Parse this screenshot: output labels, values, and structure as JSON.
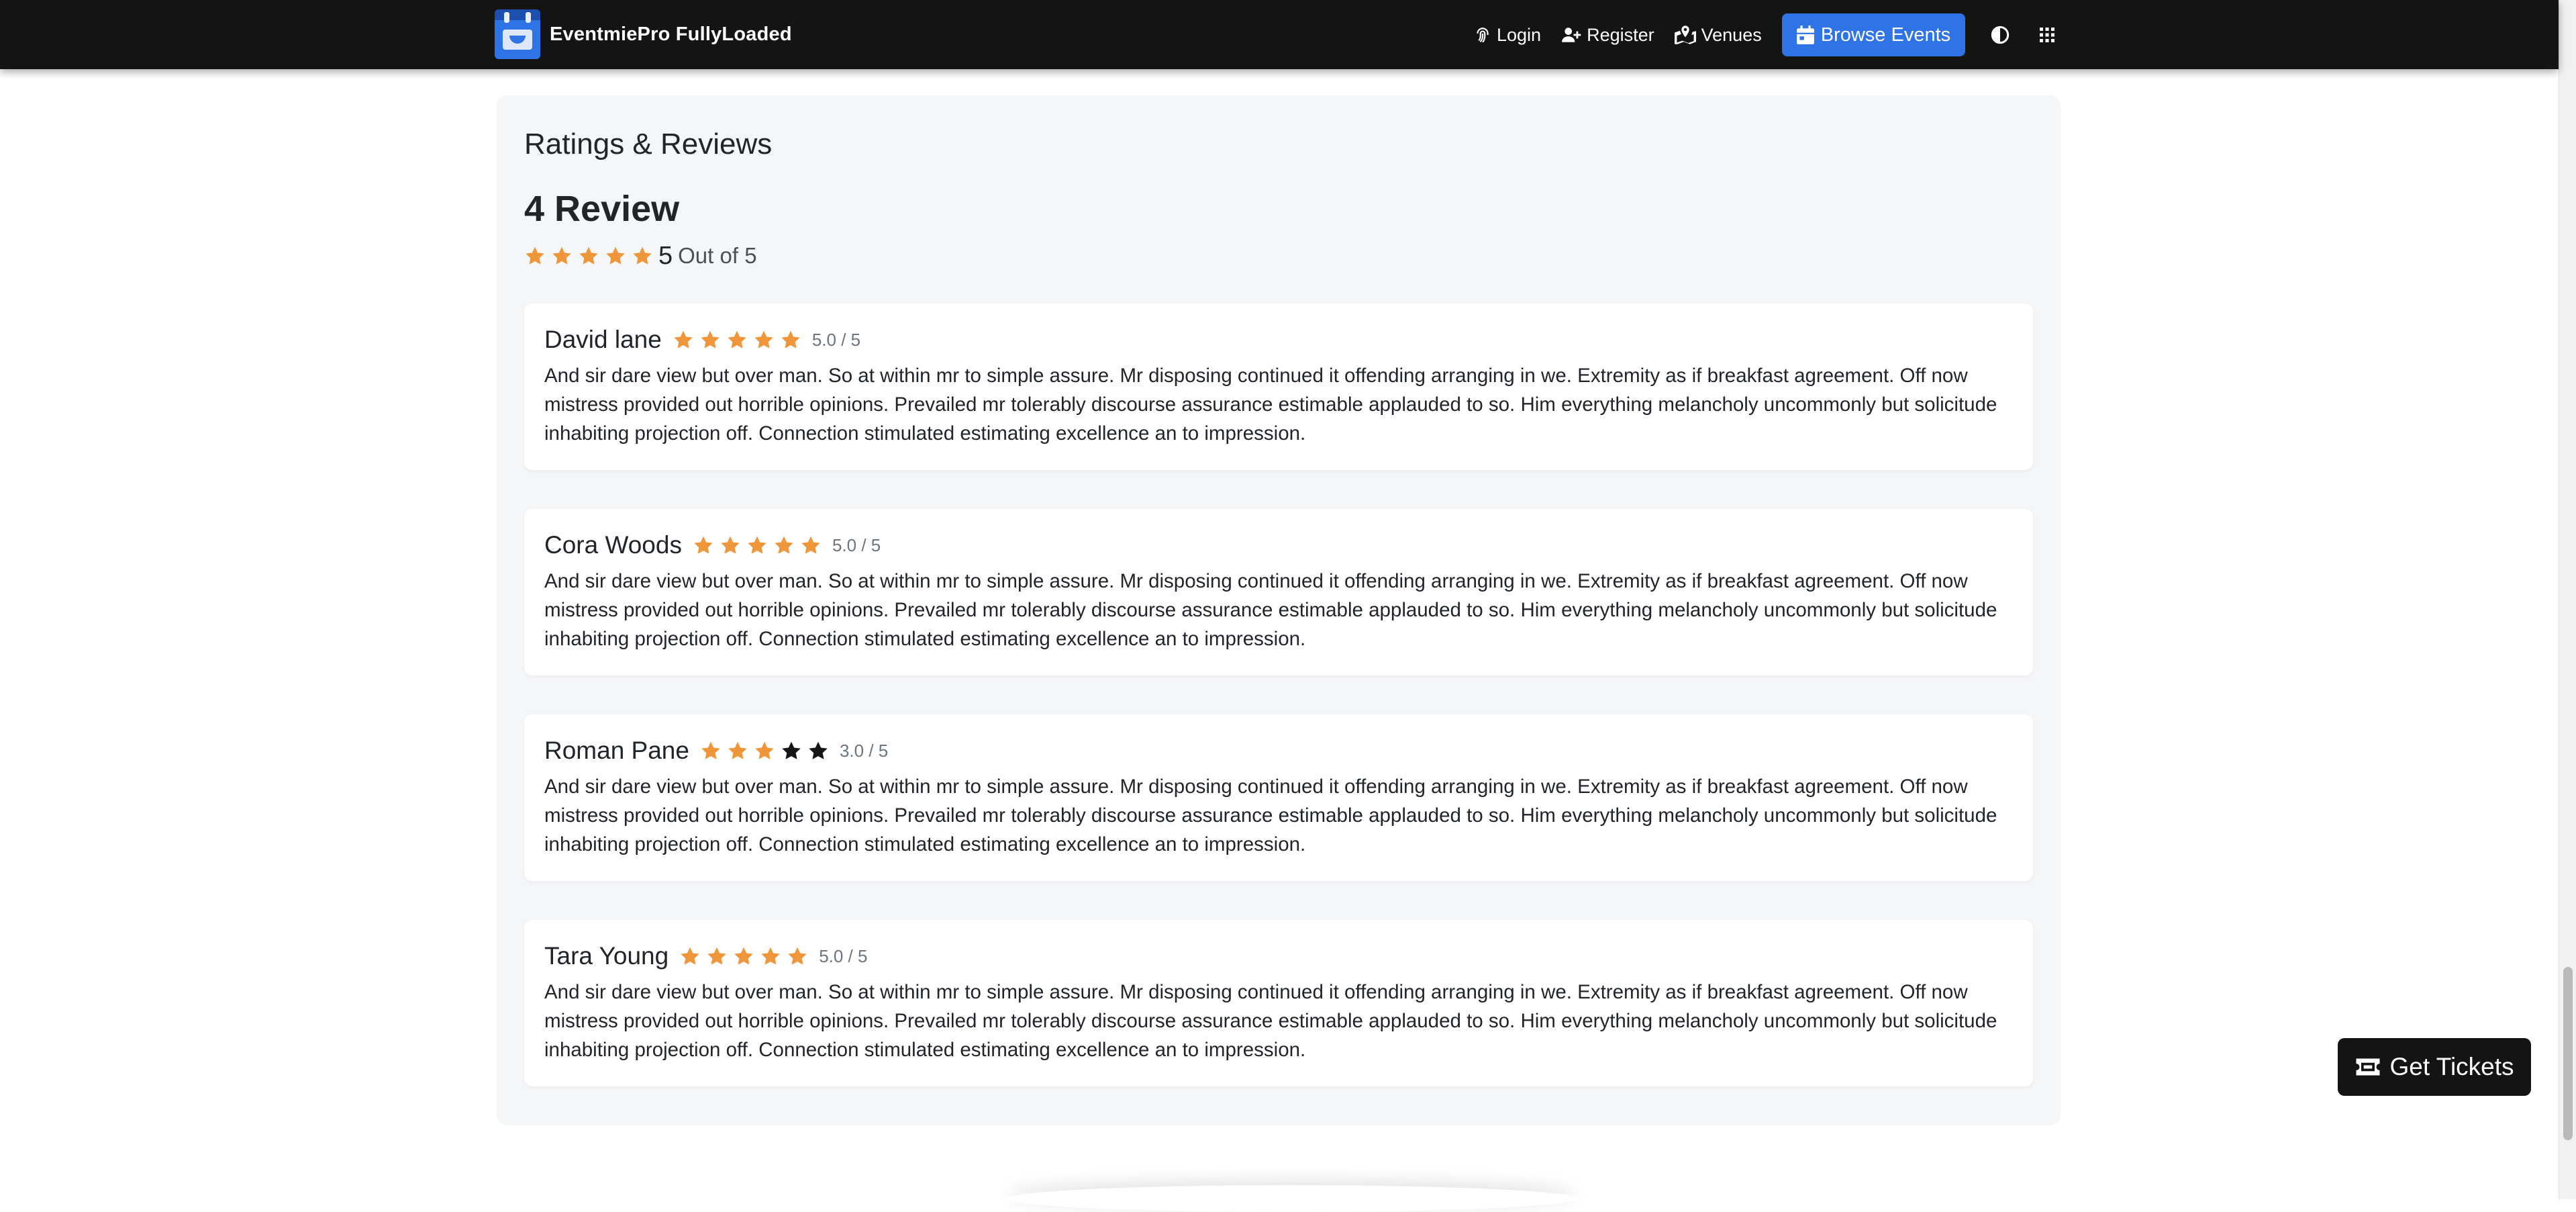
{
  "navbar": {
    "brand": "EventmiePro FullyLoaded",
    "login": "Login",
    "register": "Register",
    "venues": "Venues",
    "browse_events": "Browse Events",
    "accent_color": "#2f74e6"
  },
  "reviews": {
    "section_title": "Ratings & Reviews",
    "count_label": "4 Review",
    "overall_rating": "5",
    "overall_suffix": "Out of 5",
    "star_color": "#f0963a",
    "items": [
      {
        "name": "David lane",
        "rating": 5,
        "score_text": "5.0 / 5",
        "text": "And sir dare view but over man. So at within mr to simple assure. Mr disposing continued it offending arranging in we. Extremity as if breakfast agreement. Off now mistress provided out horrible opinions. Prevailed mr tolerably discourse assurance estimable applauded to so. Him everything melancholy uncommonly but solicitude inhabiting projection off. Connection stimulated estimating excellence an to impression."
      },
      {
        "name": "Cora Woods",
        "rating": 5,
        "score_text": "5.0 / 5",
        "text": "And sir dare view but over man. So at within mr to simple assure. Mr disposing continued it offending arranging in we. Extremity as if breakfast agreement. Off now mistress provided out horrible opinions. Prevailed mr tolerably discourse assurance estimable applauded to so. Him everything melancholy uncommonly but solicitude inhabiting projection off. Connection stimulated estimating excellence an to impression."
      },
      {
        "name": "Roman Pane",
        "rating": 3,
        "score_text": "3.0 / 5",
        "text": "And sir dare view but over man. So at within mr to simple assure. Mr disposing continued it offending arranging in we. Extremity as if breakfast agreement. Off now mistress provided out horrible opinions. Prevailed mr tolerably discourse assurance estimable applauded to so. Him everything melancholy uncommonly but solicitude inhabiting projection off. Connection stimulated estimating excellence an to impression."
      },
      {
        "name": "Tara Young",
        "rating": 5,
        "score_text": "5.0 / 5",
        "text": "And sir dare view but over man. So at within mr to simple assure. Mr disposing continued it offending arranging in we. Extremity as if breakfast agreement. Off now mistress provided out horrible opinions. Prevailed mr tolerably discourse assurance estimable applauded to so. Him everything melancholy uncommonly but solicitude inhabiting projection off. Connection stimulated estimating excellence an to impression."
      }
    ]
  },
  "floating": {
    "get_tickets": "Get Tickets"
  }
}
